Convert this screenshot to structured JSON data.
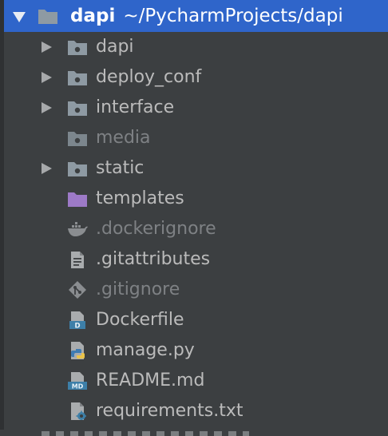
{
  "project": {
    "name": "dapi",
    "path": "~/PycharmProjects/dapi"
  },
  "colors": {
    "selection": "#2f65ca",
    "background": "#3c3f41",
    "text": "#bbbbbb",
    "dimmed_text": "#7e8184",
    "folder_icon": "#8e9aa3",
    "templates_folder_icon": "#9d7ac7"
  },
  "tree": {
    "items": [
      {
        "label": "dapi",
        "icon": "folder-icon",
        "expandable": true
      },
      {
        "label": "deploy_conf",
        "icon": "folder-icon",
        "expandable": true
      },
      {
        "label": "interface",
        "icon": "folder-icon",
        "expandable": true
      },
      {
        "label": "media",
        "icon": "folder-icon",
        "expandable": false
      },
      {
        "label": "static",
        "icon": "folder-icon",
        "expandable": true
      },
      {
        "label": "templates",
        "icon": "templates-folder-icon",
        "expandable": false
      },
      {
        "label": ".dockerignore",
        "icon": "docker-icon",
        "expandable": false
      },
      {
        "label": ".gitattributes",
        "icon": "text-file-icon",
        "expandable": false
      },
      {
        "label": ".gitignore",
        "icon": "git-icon",
        "expandable": false
      },
      {
        "label": "Dockerfile",
        "icon": "dockerfile-icon",
        "expandable": false
      },
      {
        "label": "manage.py",
        "icon": "python-file-icon",
        "expandable": false
      },
      {
        "label": "README.md",
        "icon": "markdown-file-icon",
        "expandable": false
      },
      {
        "label": "requirements.txt",
        "icon": "requirements-file-icon",
        "expandable": false
      }
    ]
  }
}
